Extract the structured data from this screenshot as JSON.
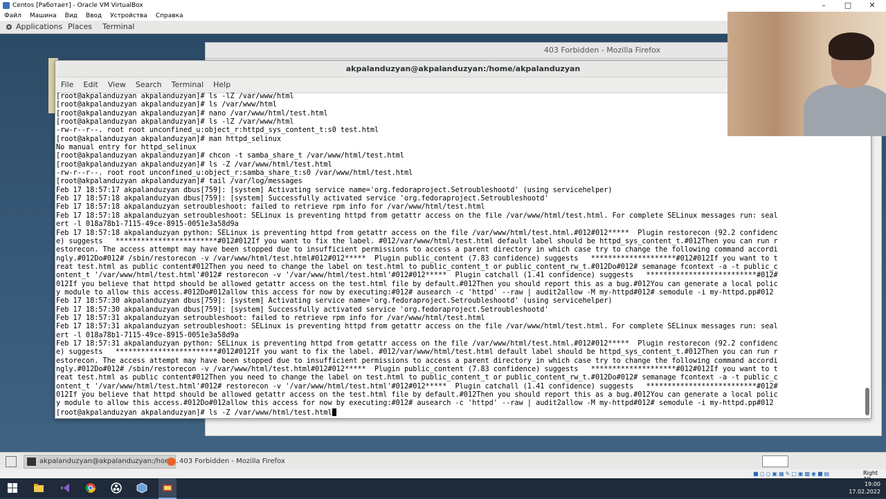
{
  "vbox": {
    "title": "Centos [Работает] - Oracle VM VirtualBox",
    "menu": [
      "Файл",
      "Машина",
      "Вид",
      "Ввод",
      "Устройства",
      "Справка"
    ],
    "status_right": "Right Alt"
  },
  "gnome": {
    "applications": "Applications",
    "places": "Places",
    "terminal": "Terminal"
  },
  "firefox": {
    "title": "403 Forbidden - Mozilla Firefox"
  },
  "terminal": {
    "title": "akpalanduzyan@akpalanduzyan:/home/akpalanduzyan",
    "menu": [
      "File",
      "Edit",
      "View",
      "Search",
      "Terminal",
      "Help"
    ],
    "lines": [
      "[root@akpalanduzyan akpalanduzyan]# ls -lZ /var/www/html",
      "[root@akpalanduzyan akpalanduzyan]# ls /var/www/html",
      "[root@akpalanduzyan akpalanduzyan]# nano /var/www/html/test.html",
      "[root@akpalanduzyan akpalanduzyan]# ls -lZ /var/www/html",
      "-rw-r--r--. root root unconfined_u:object_r:httpd_sys_content_t:s0 test.html",
      "[root@akpalanduzyan akpalanduzyan]# man httpd_selinux",
      "No manual entry for httpd_selinux",
      "[root@akpalanduzyan akpalanduzyan]# chcon -t samba_share_t /var/www/html/test.html",
      "[root@akpalanduzyan akpalanduzyan]# ls -Z /var/www/html/test.html",
      "-rw-r--r--. root root unconfined_u:object_r:samba_share_t:s0 /var/www/html/test.html",
      "[root@akpalanduzyan akpalanduzyan]# tail /var/log/messages",
      "Feb 17 18:57:17 akpalanduzyan dbus[759]: [system] Activating service name='org.fedoraproject.Setroubleshootd' (using servicehelper)",
      "Feb 17 18:57:18 akpalanduzyan dbus[759]: [system] Successfully activated service 'org.fedoraproject.Setroubleshootd'",
      "Feb 17 18:57:18 akpalanduzyan setroubleshoot: failed to retrieve rpm info for /var/www/html/test.html",
      "Feb 17 18:57:18 akpalanduzyan setroubleshoot: SELinux is preventing httpd from getattr access on the file /var/www/html/test.html. For complete SELinux messages run: seal",
      "ert -l 018a78b1-7115-49ce-8915-0051e3a58d9a",
      "Feb 17 18:57:18 akpalanduzyan python: SELinux is preventing httpd from getattr access on the file /var/www/html/test.html.#012#012*****  Plugin restorecon (92.2 confidenc",
      "e) suggests   ************************#012#012If you want to fix the label. #012/var/www/html/test.html default label should be httpd_sys_content_t.#012Then you can run r",
      "estorecon. The access attempt may have been stopped due to insufficient permissions to access a parent directory in which case try to change the following command accordi",
      "ngly.#012Do#012# /sbin/restorecon -v /var/www/html/test.html#012#012*****  Plugin public_content (7.83 confidence) suggests   ********************#012#012If you want to t",
      "reat test.html as public content#012Then you need to change the label on test.html to public_content_t or public_content_rw_t.#012Do#012# semanage fcontext -a -t public_c",
      "ontent_t '/var/www/html/test.html'#012# restorecon -v '/var/www/html/test.html'#012#012*****  Plugin catchall (1.41 confidence) suggests   **************************#012#",
      "012If you believe that httpd should be allowed getattr access on the test.html file by default.#012Then you should report this as a bug.#012You can generate a local polic",
      "y module to allow this access.#012Do#012allow this access for now by executing:#012# ausearch -c 'httpd' --raw | audit2allow -M my-httpd#012# semodule -i my-httpd.pp#012",
      "Feb 17 18:57:30 akpalanduzyan dbus[759]: [system] Activating service name='org.fedoraproject.Setroubleshootd' (using servicehelper)",
      "Feb 17 18:57:30 akpalanduzyan dbus[759]: [system] Successfully activated service 'org.fedoraproject.Setroubleshootd'",
      "Feb 17 18:57:31 akpalanduzyan setroubleshoot: failed to retrieve rpm info for /var/www/html/test.html",
      "Feb 17 18:57:31 akpalanduzyan setroubleshoot: SELinux is preventing httpd from getattr access on the file /var/www/html/test.html. For complete SELinux messages run: seal",
      "ert -l 018a78b1-7115-49ce-8915-0051e3a58d9a",
      "Feb 17 18:57:31 akpalanduzyan python: SELinux is preventing httpd from getattr access on the file /var/www/html/test.html.#012#012*****  Plugin restorecon (92.2 confidenc",
      "e) suggests   ************************#012#012If you want to fix the label. #012/var/www/html/test.html default label should be httpd_sys_content_t.#012Then you can run r",
      "estorecon. The access attempt may have been stopped due to insufficient permissions to access a parent directory in which case try to change the following command accordi",
      "ngly.#012Do#012# /sbin/restorecon -v /var/www/html/test.html#012#012*****  Plugin public_content (7.83 confidence) suggests   ********************#012#012If you want to t",
      "reat test.html as public content#012Then you need to change the label on test.html to public_content_t or public_content_rw_t.#012Do#012# semanage fcontext -a -t public_c",
      "ontent_t '/var/www/html/test.html'#012# restorecon -v '/var/www/html/test.html'#012#012*****  Plugin catchall (1.41 confidence) suggests   **************************#012#",
      "012If you believe that httpd should be allowed getattr access on the test.html file by default.#012Then you should report this as a bug.#012You can generate a local polic",
      "y module to allow this access.#012Do#012allow this access for now by executing:#012# ausearch -c 'httpd' --raw | audit2allow -M my-httpd#012# semodule -i my-httpd.pp#012"
    ],
    "prompt": "[root@akpalanduzyan akpalanduzyan]# ls -Z /var/www/html/test.html"
  },
  "taskbar": {
    "task_terminal": "akpalanduzyan@akpalanduzyan:/hom...",
    "task_firefox": "403 Forbidden - Mozilla Firefox"
  },
  "windows": {
    "time": "19:00",
    "date": "17.02.2022"
  },
  "colors": {
    "terminal_bg": "#ffffff",
    "desktop": "#2b4a66",
    "win_taskbar": "#1f2b3a"
  }
}
